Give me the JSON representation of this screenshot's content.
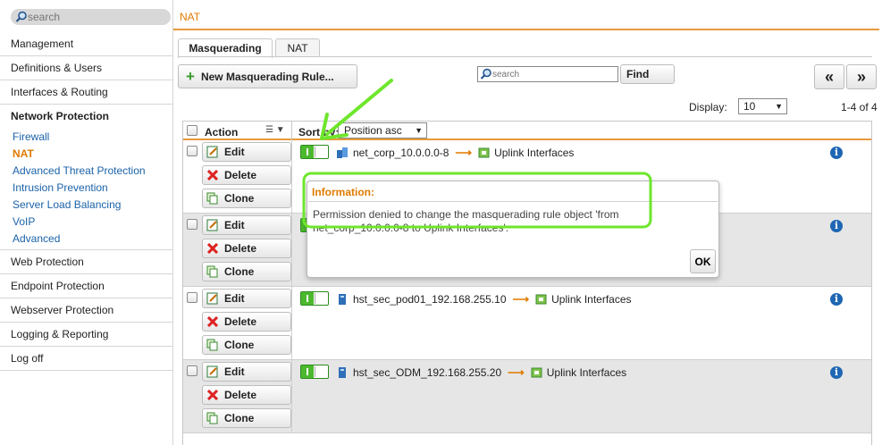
{
  "sidebar": {
    "search_placeholder": "search",
    "main_items": [
      "Management",
      "Definitions & Users",
      "Interfaces & Routing"
    ],
    "active_section": "Network Protection",
    "sub_items": [
      "Firewall",
      "NAT",
      "Advanced Threat Protection",
      "Intrusion Prevention",
      "Server Load Balancing",
      "VoIP",
      "Advanced"
    ],
    "active_sub_item": "NAT",
    "lower_items": [
      "Web Protection",
      "Endpoint Protection",
      "Webserver Protection",
      "Logging & Reporting",
      "Log off"
    ]
  },
  "header": {
    "title": "NAT"
  },
  "tabs": [
    {
      "label": "Masquerading",
      "active": true
    },
    {
      "label": "NAT",
      "active": false
    }
  ],
  "toolbar": {
    "new_rule_label": "New Masquerading Rule...",
    "search_placeholder": "search",
    "find_label": "Find",
    "prev_label": "«",
    "next_label": "»",
    "display_label": "Display:",
    "display_value": "10",
    "range_text": "1-4 of 4"
  },
  "table": {
    "action_header": "Action",
    "sort_by_label": "Sort by:",
    "sort_value": "Position asc",
    "buttons": {
      "edit": "Edit",
      "delete": "Delete",
      "clone": "Clone"
    },
    "rows": [
      {
        "network": "net_corp_10.0.0.0-8",
        "interface": "Uplink Interfaces",
        "icon": "network-icon",
        "enabled": true
      },
      {
        "network": "",
        "interface": "",
        "icon": "network-icon",
        "enabled": true
      },
      {
        "network": "hst_sec_pod01_192.168.255.10",
        "interface": "Uplink Interfaces",
        "icon": "host-icon",
        "enabled": true
      },
      {
        "network": "hst_sec_ODM_192.168.255.20",
        "interface": "Uplink Interfaces",
        "icon": "host-icon",
        "enabled": true
      }
    ]
  },
  "popup": {
    "title": "Information:",
    "message": "Permission denied to change the masquerading rule object 'from net_corp_10.0.0.0-8 to Uplink Interfaces'.",
    "ok_label": "OK"
  },
  "colors": {
    "accent": "#e07a00",
    "link": "#1a62a8",
    "toggle_on": "#4cb82e",
    "annotation": "#6ee62c"
  }
}
